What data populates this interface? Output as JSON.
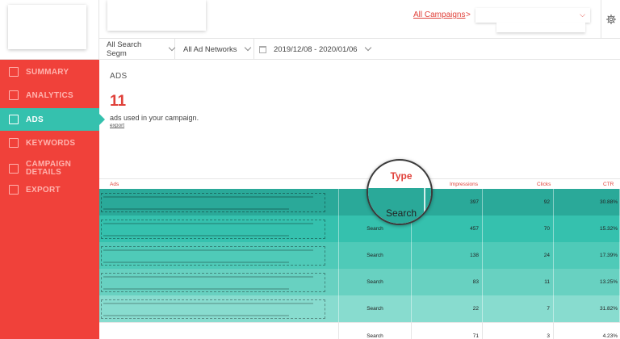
{
  "sidebar": {
    "items": [
      {
        "label": "SUMMARY",
        "icon": "summary-icon"
      },
      {
        "label": "ANALYTICS",
        "icon": "analytics-icon"
      },
      {
        "label": "ADS",
        "icon": "ads-list-icon",
        "active": true
      },
      {
        "label": "KEYWORDS",
        "icon": "keywords-icon"
      },
      {
        "label_line1": "CAMPAIGN",
        "label_line2": "DETAILS",
        "icon": "campaign-details-icon"
      },
      {
        "label": "EXPORT",
        "icon": "export-icon"
      }
    ]
  },
  "header": {
    "campaigns_link": "All Campaigns",
    "separator": ">",
    "settings_icon": "gear-icon"
  },
  "filters": {
    "search_segment": "All Search Segm",
    "ad_networks": "All Ad Networks",
    "date_range": "2019/12/08 - 2020/01/06"
  },
  "page": {
    "title": "ADS",
    "count": "11",
    "caption": "ads used in your campaign.",
    "export": "export"
  },
  "table": {
    "columns": [
      "Ads",
      "Impressions",
      "Clicks",
      "CTR"
    ],
    "rows": [
      {
        "type": "",
        "impressions": "397",
        "clicks": "92",
        "ctr": "30.88%",
        "bg": "#2aa999"
      },
      {
        "type": "Search",
        "impressions": "457",
        "clicks": "70",
        "ctr": "15.32%",
        "bg": "#35c1ae"
      },
      {
        "type": "Search",
        "impressions": "138",
        "clicks": "24",
        "ctr": "17.39%",
        "bg": "#4fcab8"
      },
      {
        "type": "Search",
        "impressions": "83",
        "clicks": "11",
        "ctr": "13.25%",
        "bg": "#68d1c1"
      },
      {
        "type": "Search",
        "impressions": "22",
        "clicks": "7",
        "ctr": "31.82%",
        "bg": "#88dccf"
      },
      {
        "type": "Search",
        "impressions": "71",
        "clicks": "3",
        "ctr": "4.23%",
        "bg": "#ffffff"
      }
    ]
  },
  "magnifier": {
    "header": "Type",
    "value": "Search"
  },
  "colors": {
    "sidebar": "#f0413a",
    "accent": "#35c1ae",
    "link": "#e0413a"
  }
}
